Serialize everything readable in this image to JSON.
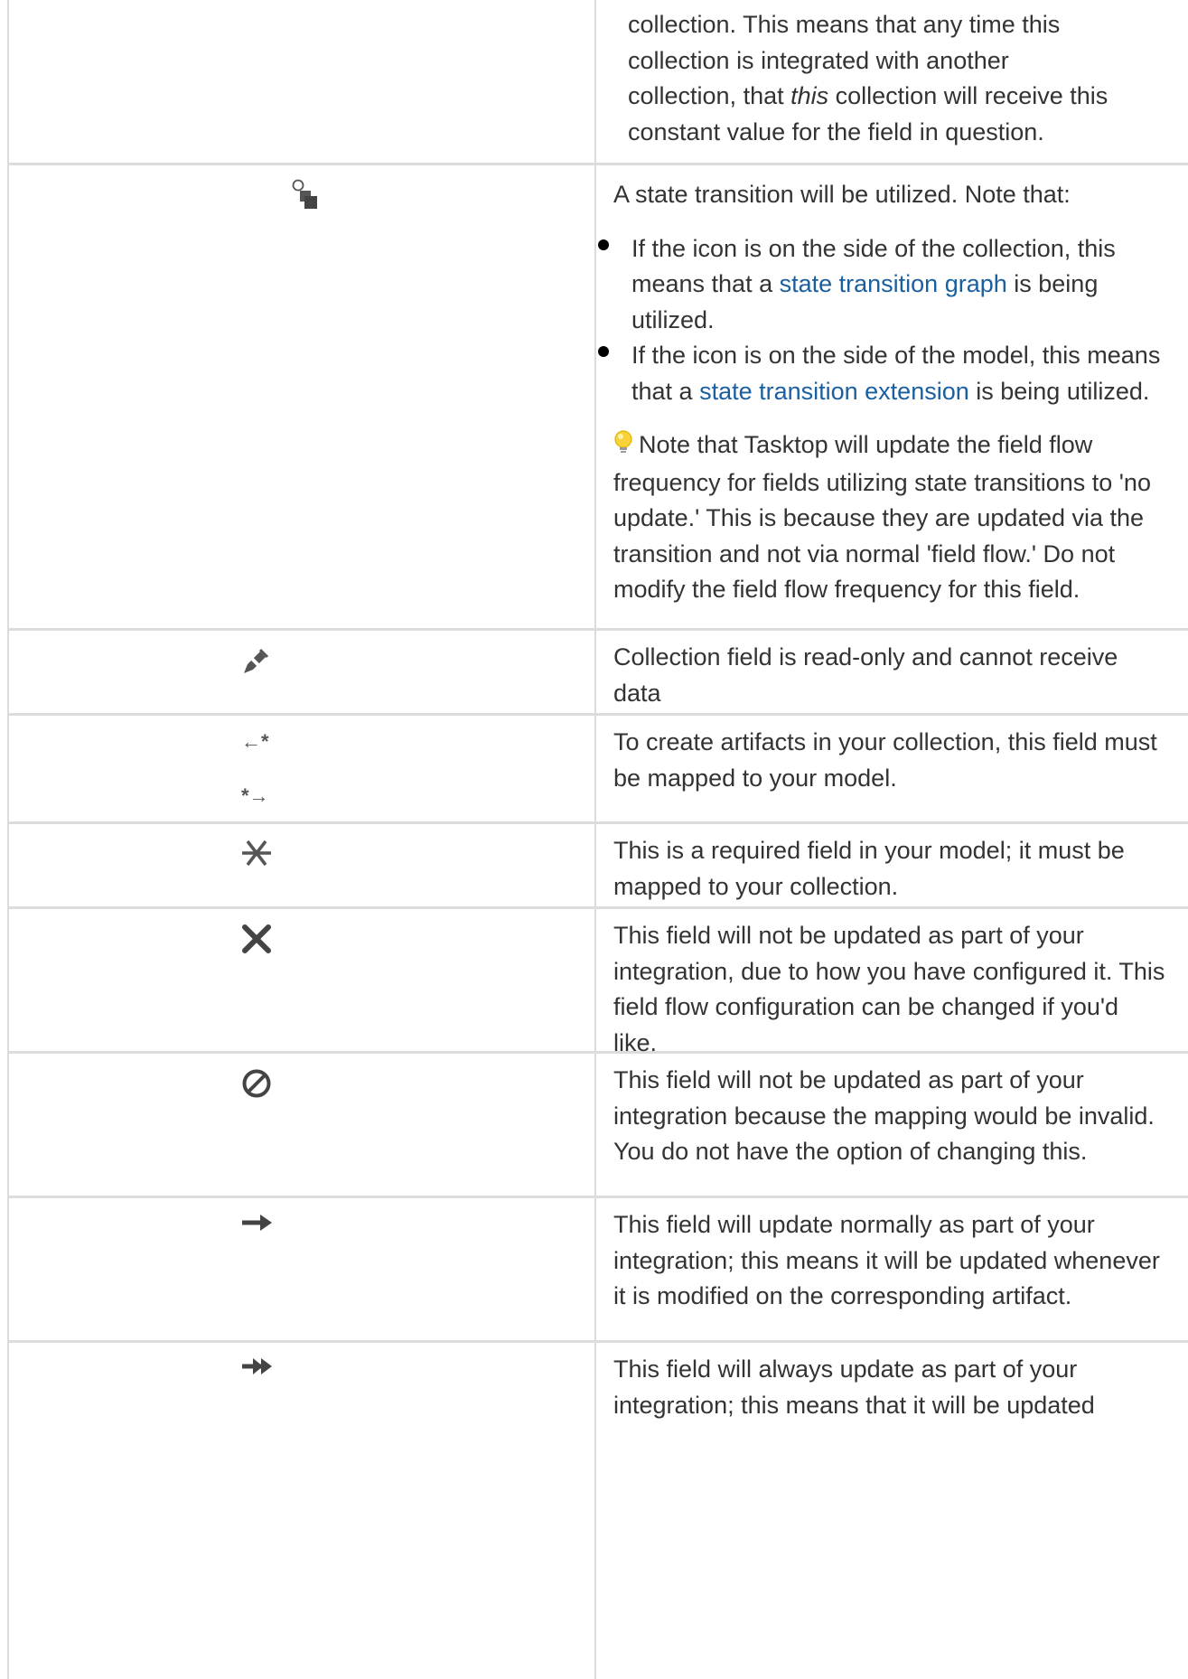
{
  "top_row": {
    "line1": "collection. This means that any time this",
    "line2": "collection is integrated with another",
    "line3_pre": "collection, that ",
    "line3_em": "this",
    "line3_post": " collection will receive this",
    "line4": "constant value for the field in question."
  },
  "rows": [
    {
      "icon": "state-transition-icon",
      "intro": "A state transition will be utilized. Note that:",
      "bullets": [
        {
          "pre": "If the icon is on the side of the collection, this means that a ",
          "link": "state transition graph",
          "post": " is being utilized."
        },
        {
          "pre": "If the icon is on the side of the model, this means that a ",
          "link": "state transition extension",
          "post": " is being utilized."
        }
      ],
      "note_icon": "lightbulb-icon",
      "note": "Note that Tasktop will update the field flow frequency for fields utilizing state transitions to 'no update.' This is because they are updated via the transition and not via normal 'field flow.' Do not modify the field flow frequency for this field."
    },
    {
      "icon": "read-only-pencil-icon",
      "text": "Collection field is read-only and cannot receive data"
    },
    {
      "icon": "arrow-asterisk-icons",
      "icon_top_text": "←*",
      "icon_bottom_text": "*→",
      "text": "To create artifacts in your collection, this field must be mapped to your model."
    },
    {
      "icon": "required-asterisk-icon",
      "text": "This is a required field in your model; it must be mapped to your collection."
    },
    {
      "icon": "x-icon",
      "text": "This field will not be updated as part of your integration, due to how you have configured it. This field flow configuration can be changed if you'd like."
    },
    {
      "icon": "prohibited-icon",
      "text": "This field will not be updated as part of your integration because the mapping would be invalid. You do not have the option of changing this."
    },
    {
      "icon": "right-arrow-icon",
      "text": "This field will update normally as part of your integration; this means it will be updated whenever it is modified on the corresponding artifact."
    },
    {
      "icon": "double-right-arrow-icon",
      "text": "This field will always update as part of your integration; this means that it will be updated"
    }
  ]
}
